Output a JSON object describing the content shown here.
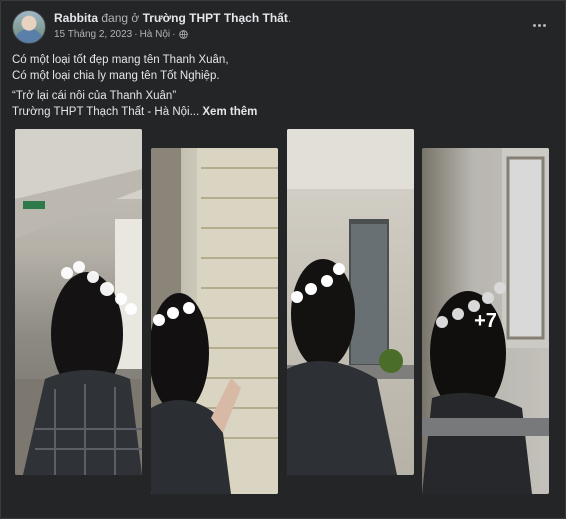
{
  "post": {
    "author": "Rabbita",
    "at_text": "đang ở",
    "location": "Trường THPT Thạch Thất",
    "period": ".",
    "date": "15 Tháng 2, 2023",
    "place": "Hà Nội",
    "separator": "·",
    "audience_icon": "globe-icon",
    "menu_icon": "more-horizontal-icon"
  },
  "caption": {
    "line1": "Có một loại tốt đẹp mang tên Thanh Xuân,",
    "line2": "Có một loại chia ly mang tên Tốt Nghiệp.",
    "line3": "“Trở lại cái nôi của Thanh Xuân”",
    "line4": "Trường THPT Thạch Thất - Hà Nội...",
    "see_more": "Xem thêm"
  },
  "gallery": {
    "more_count": "+7"
  },
  "colors": {
    "background": "#242526",
    "text_primary": "#e4e6eb",
    "text_secondary": "#b0b3b8"
  }
}
